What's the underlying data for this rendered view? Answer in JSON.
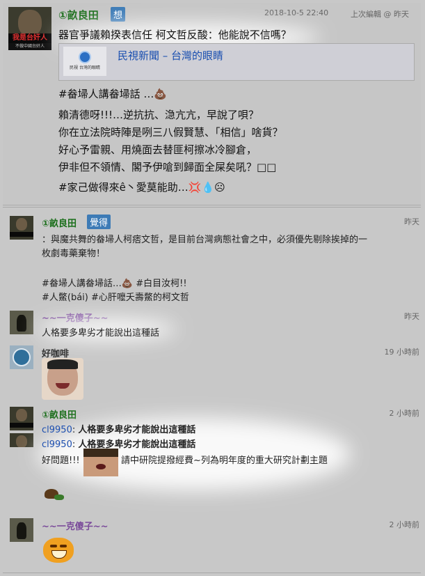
{
  "post": {
    "author": "①畝良田",
    "badge": "想",
    "timestamp": "2018-10-5 22:40",
    "edited": "上次編輯 @ 昨天",
    "headline": "器官爭議賴揆表信任 柯文哲反酸：他能說不信嗎？",
    "link_title": "民視新聞 – 台灣的眼睛",
    "link_thumb_label": "民視 台灣的眼睛",
    "avatar_band": "我是台奸人",
    "avatar_sub": "不做中國台奸人",
    "lines": [
      "#畚埽人講畚埽話 …💩",
      "賴清德呀!!!…逆抗抗、㴔亢亢，早說了唄？",
      "你在立法院時陣是咧三八假賢慧、「相信」啥貨？",
      "好心予雷親、用燒面去替匪柯擦冰冷腳倉，",
      "伊非但不領情、閣予伊嗆到歸面全屎矣吼？□□",
      "#家己做得來ê丶愛莫能助…💢💧☹"
    ]
  },
  "comments": [
    {
      "author": "①畝良田",
      "badge": "覺得",
      "time": "昨天",
      "lines": [
        "：與魔共舞的畚埽人柯痞文哲，是目前台灣病態社會之中，必須優先剔除挨掉的一",
        "枚劇毒藥棄物！",
        "",
        "#畚埽人講畚埽話…💩 #白目汝柯!!",
        "#人鱉(bái) #心肝嚒夭壽鱉的柯文哲"
      ]
    },
    {
      "author": "~~一克傻子~~",
      "time": "昨天",
      "text": "人格要多卑劣才能說出這種話"
    },
    {
      "author": "好咖啡",
      "time": "19 小時前"
    },
    {
      "author": "①畝良田",
      "time": "2 小時前",
      "quotes": [
        {
          "user": "cl9950",
          "text": "人格要多卑劣才能說出這種話"
        },
        {
          "user": "cl9950",
          "text": "人格要多卑劣才能說出這種話"
        }
      ],
      "prefix": "好問題!!!",
      "reply": "請中研院提撥經費~列為明年度的重大研究計劃主題"
    },
    {
      "author": "~~一克傻子~~",
      "time": "2 小時前"
    }
  ],
  "colors": {
    "author_green": "#1a6e1a",
    "author_purple": "#7a4a9a",
    "author_dark": "#333333",
    "link_blue": "#1a4fb0",
    "badge_blue": "#3d7bb6"
  }
}
